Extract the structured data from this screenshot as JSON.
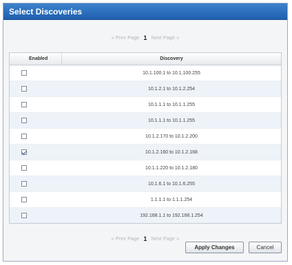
{
  "dialog": {
    "title": "Select Discoveries"
  },
  "pager": {
    "prev_label": "« Prev Page",
    "page": "1",
    "next_label": "Next Page »"
  },
  "table": {
    "columns": [
      "Enabled",
      "Discovery"
    ],
    "rows": [
      {
        "enabled": false,
        "discovery": "10.1.100.1 to 10.1.100.255"
      },
      {
        "enabled": false,
        "discovery": "10.1.2.1 to 10.1.2.254"
      },
      {
        "enabled": false,
        "discovery": "10.1.1.1 to 10.1.1.255"
      },
      {
        "enabled": false,
        "discovery": "10.1.1.1 to 10.1.1.255"
      },
      {
        "enabled": false,
        "discovery": "10.1.2.170 to 10.1.2.200"
      },
      {
        "enabled": true,
        "discovery": "10.1.2.160 to 10.1.2.168"
      },
      {
        "enabled": false,
        "discovery": "10.1.1.220 to 10.1.2.180"
      },
      {
        "enabled": false,
        "discovery": "10.1.6.1 to 10.1.6.255"
      },
      {
        "enabled": false,
        "discovery": "1.1.1.1 to 1.1.1.254"
      },
      {
        "enabled": false,
        "discovery": "192.168.1.1 to 192.168.1.254"
      }
    ]
  },
  "buttons": {
    "apply": "Apply Changes",
    "cancel": "Cancel"
  }
}
